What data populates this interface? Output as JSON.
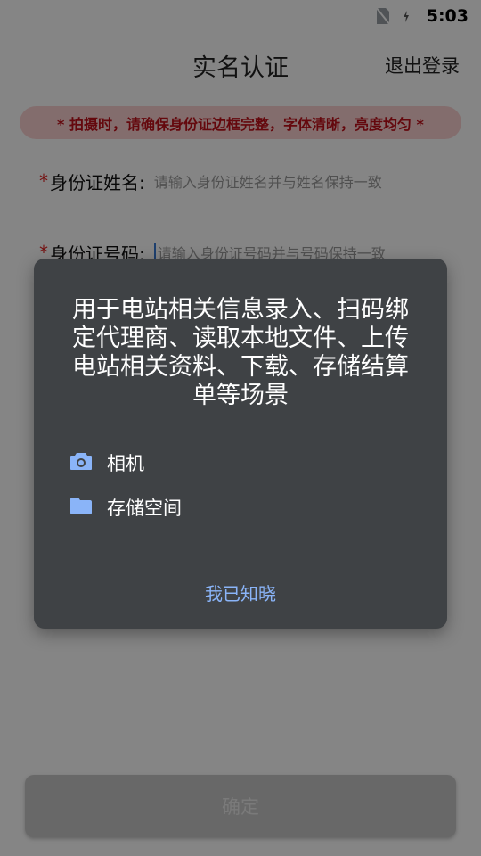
{
  "status_bar": {
    "time": "5:03"
  },
  "header": {
    "title": "实名认证",
    "logout_label": "退出登录"
  },
  "notice": {
    "text": "* 拍摄时，请确保身份证边框完整，字体清晰，亮度均匀 *"
  },
  "form": {
    "name_row": {
      "required_mark": "*",
      "label": "身份证姓名:",
      "placeholder": "请输入身份证姓名并与姓名保持一致"
    },
    "id_row": {
      "required_mark": "*",
      "label": "身份证号码:",
      "placeholder": "请输入身份证号码并与号码保持一致"
    }
  },
  "confirm_label": "确定",
  "dialog": {
    "message": "用于电站相关信息录入、扫码绑定代理商、读取本地文件、上传电站相关资料、下载、存储结算单等场景",
    "permissions": [
      {
        "icon": "camera-icon",
        "label": "相机"
      },
      {
        "icon": "folder-icon",
        "label": "存储空间"
      }
    ],
    "ack_label": "我已知晓",
    "accent_color": "#8ab4f8"
  }
}
